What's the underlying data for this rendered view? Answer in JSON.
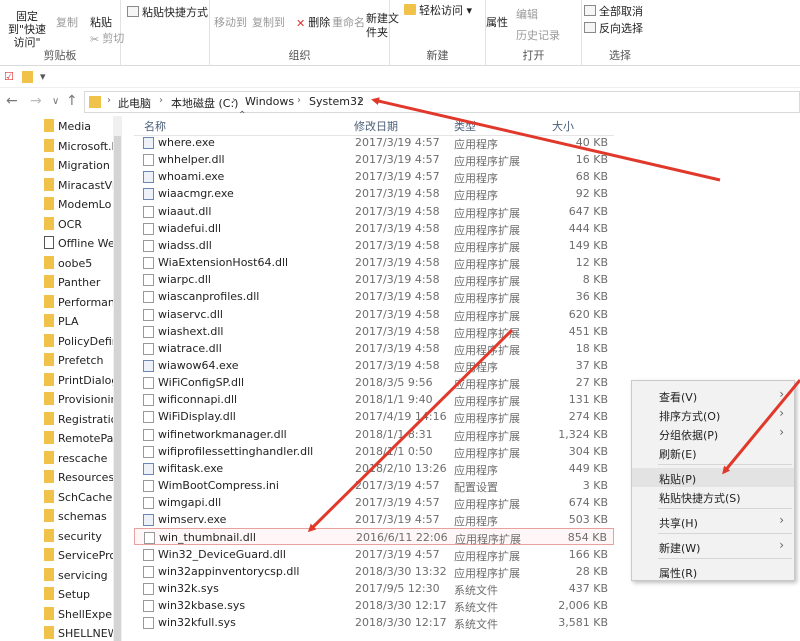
{
  "ribbon": {
    "clipboard": {
      "pin_label": "固定到\"快速访问\"",
      "copy": "复制",
      "paste": "粘贴",
      "paste_shortcut": "粘贴快捷方式",
      "cut": "剪切",
      "group_label": "剪贴板"
    },
    "organize": {
      "move_to": "移动到",
      "copy_to": "复制到",
      "delete": "删除",
      "rename": "重命名",
      "group_label": "组织"
    },
    "new": {
      "new_folder": "新建文件夹",
      "easy_access": "轻松访问",
      "group_label": "新建"
    },
    "open": {
      "properties": "属性",
      "edit": "编辑",
      "history": "历史记录",
      "group_label": "打开"
    },
    "select": {
      "select_all": "全部取消",
      "invert": "反向选择",
      "group_label": "选择"
    }
  },
  "breadcrumb": [
    "此电脑",
    "本地磁盘 (C:)",
    "Windows",
    "System32"
  ],
  "nav_items": [
    {
      "label": "Media"
    },
    {
      "label": "Microsoft.I"
    },
    {
      "label": "Migration"
    },
    {
      "label": "MiracastVi"
    },
    {
      "label": "ModemLo"
    },
    {
      "label": "OCR"
    },
    {
      "label": "Offline We"
    },
    {
      "label": "oobe5"
    },
    {
      "label": "Panther"
    },
    {
      "label": "Performan"
    },
    {
      "label": "PLA"
    },
    {
      "label": "PolicyDefin"
    },
    {
      "label": "Prefetch"
    },
    {
      "label": "PrintDialog"
    },
    {
      "label": "Provisionin"
    },
    {
      "label": "Registratio"
    },
    {
      "label": "RemotePac"
    },
    {
      "label": "rescache"
    },
    {
      "label": "Resources"
    },
    {
      "label": "SchCache"
    },
    {
      "label": "schemas"
    },
    {
      "label": "security"
    },
    {
      "label": "ServicePro"
    },
    {
      "label": "servicing"
    },
    {
      "label": "Setup"
    },
    {
      "label": "ShellExperi"
    },
    {
      "label": "SHELLNEW"
    }
  ],
  "columns": {
    "name": "名称",
    "date": "修改日期",
    "type": "类型",
    "size": "大小"
  },
  "files": [
    {
      "name": "where.exe",
      "date": "2017/3/19 4:57",
      "type": "应用程序",
      "size": "40 KB",
      "kind": "exe"
    },
    {
      "name": "whhelper.dll",
      "date": "2017/3/19 4:57",
      "type": "应用程序扩展",
      "size": "16 KB",
      "kind": "dll"
    },
    {
      "name": "whoami.exe",
      "date": "2017/3/19 4:57",
      "type": "应用程序",
      "size": "68 KB",
      "kind": "exe"
    },
    {
      "name": "wiaacmgr.exe",
      "date": "2017/3/19 4:58",
      "type": "应用程序",
      "size": "92 KB",
      "kind": "exe"
    },
    {
      "name": "wiaaut.dll",
      "date": "2017/3/19 4:58",
      "type": "应用程序扩展",
      "size": "647 KB",
      "kind": "dll"
    },
    {
      "name": "wiadefui.dll",
      "date": "2017/3/19 4:58",
      "type": "应用程序扩展",
      "size": "444 KB",
      "kind": "dll"
    },
    {
      "name": "wiadss.dll",
      "date": "2017/3/19 4:58",
      "type": "应用程序扩展",
      "size": "149 KB",
      "kind": "dll"
    },
    {
      "name": "WiaExtensionHost64.dll",
      "date": "2017/3/19 4:58",
      "type": "应用程序扩展",
      "size": "12 KB",
      "kind": "dll"
    },
    {
      "name": "wiarpc.dll",
      "date": "2017/3/19 4:58",
      "type": "应用程序扩展",
      "size": "8 KB",
      "kind": "dll"
    },
    {
      "name": "wiascanprofiles.dll",
      "date": "2017/3/19 4:58",
      "type": "应用程序扩展",
      "size": "36 KB",
      "kind": "dll"
    },
    {
      "name": "wiaservc.dll",
      "date": "2017/3/19 4:58",
      "type": "应用程序扩展",
      "size": "620 KB",
      "kind": "dll"
    },
    {
      "name": "wiashext.dll",
      "date": "2017/3/19 4:58",
      "type": "应用程序扩展",
      "size": "451 KB",
      "kind": "dll"
    },
    {
      "name": "wiatrace.dll",
      "date": "2017/3/19 4:58",
      "type": "应用程序扩展",
      "size": "18 KB",
      "kind": "dll"
    },
    {
      "name": "wiawow64.exe",
      "date": "2017/3/19 4:58",
      "type": "应用程序",
      "size": "37 KB",
      "kind": "exe"
    },
    {
      "name": "WiFiConfigSP.dll",
      "date": "2018/3/5 9:56",
      "type": "应用程序扩展",
      "size": "27 KB",
      "kind": "dll"
    },
    {
      "name": "wificonnapi.dll",
      "date": "2018/1/1 9:40",
      "type": "应用程序扩展",
      "size": "131 KB",
      "kind": "dll"
    },
    {
      "name": "WiFiDisplay.dll",
      "date": "2017/4/19 14:16",
      "type": "应用程序扩展",
      "size": "274 KB",
      "kind": "dll"
    },
    {
      "name": "wifinetworkmanager.dll",
      "date": "2018/1/1 8:31",
      "type": "应用程序扩展",
      "size": "1,324 KB",
      "kind": "dll"
    },
    {
      "name": "wifiprofilessettinghandler.dll",
      "date": "2018/1/1 0:50",
      "type": "应用程序扩展",
      "size": "304 KB",
      "kind": "dll"
    },
    {
      "name": "wifitask.exe",
      "date": "2018/2/10 13:26",
      "type": "应用程序",
      "size": "449 KB",
      "kind": "exe"
    },
    {
      "name": "WimBootCompress.ini",
      "date": "2017/3/19 4:57",
      "type": "配置设置",
      "size": "3 KB",
      "kind": "ini"
    },
    {
      "name": "wimgapi.dll",
      "date": "2017/3/19 4:57",
      "type": "应用程序扩展",
      "size": "674 KB",
      "kind": "dll"
    },
    {
      "name": "wimserv.exe",
      "date": "2017/3/19 4:57",
      "type": "应用程序",
      "size": "503 KB",
      "kind": "exe"
    },
    {
      "name": "win_thumbnail.dll",
      "date": "2016/6/11 22:06",
      "type": "应用程序扩展",
      "size": "854 KB",
      "kind": "dll",
      "highlight": true
    },
    {
      "name": "Win32_DeviceGuard.dll",
      "date": "2017/3/19 4:57",
      "type": "应用程序扩展",
      "size": "166 KB",
      "kind": "dll"
    },
    {
      "name": "win32appinventorycsp.dll",
      "date": "2018/3/30 13:32",
      "type": "应用程序扩展",
      "size": "28 KB",
      "kind": "dll"
    },
    {
      "name": "win32k.sys",
      "date": "2017/9/5 12:30",
      "type": "系统文件",
      "size": "437 KB",
      "kind": "sys"
    },
    {
      "name": "win32kbase.sys",
      "date": "2018/3/30 12:17",
      "type": "系统文件",
      "size": "2,006 KB",
      "kind": "sys"
    },
    {
      "name": "win32kfull.sys",
      "date": "2018/3/30 12:17",
      "type": "系统文件",
      "size": "3,581 KB",
      "kind": "sys"
    }
  ],
  "context_menu": {
    "view": "查看(V)",
    "sort_by": "排序方式(O)",
    "group_by": "分组依据(P)",
    "refresh": "刷新(E)",
    "paste": "粘贴(P)",
    "paste_shortcut": "粘贴快捷方式(S)",
    "share": "共享(H)",
    "new": "新建(W)",
    "properties": "属性(R)"
  },
  "colors": {
    "annotation_arrow": "#e0392b",
    "folder": "#f1c24a"
  }
}
